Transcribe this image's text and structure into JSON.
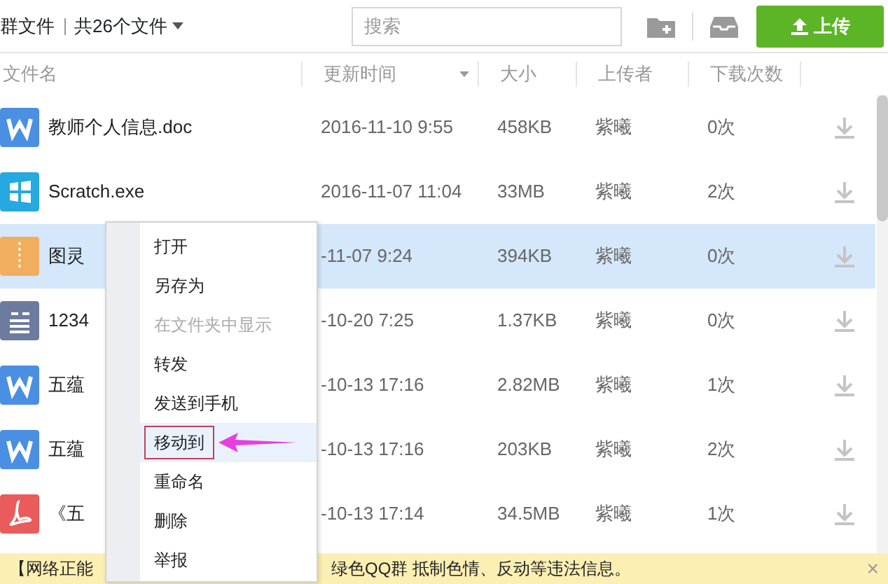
{
  "toolbar": {
    "title": "群文件",
    "file_count": "共26个文件",
    "search": {
      "placeholder": "搜索"
    },
    "upload_button": "上传"
  },
  "table": {
    "columns": [
      "文件名",
      "更新时间",
      "大小",
      "上传者",
      "下载次数"
    ],
    "rows": [
      {
        "kind": "doc",
        "name": "教师个人信息.doc",
        "time": "2016-11-10 9:55",
        "size": "458KB",
        "uploader": "紫曦",
        "downloads": "0次",
        "selected": false
      },
      {
        "kind": "exe",
        "name": "Scratch.exe",
        "time": "2016-11-07 11:04",
        "size": "33MB",
        "uploader": "紫曦",
        "downloads": "2次",
        "selected": false
      },
      {
        "kind": "zip",
        "name": "图灵",
        "time": "-11-07 9:24",
        "size": "394KB",
        "uploader": "紫曦",
        "downloads": "0次",
        "selected": true
      },
      {
        "kind": "txt",
        "name": "1234",
        "time": "-10-20 7:25",
        "size": "1.37KB",
        "uploader": "紫曦",
        "downloads": "0次",
        "selected": false
      },
      {
        "kind": "doc",
        "name": "五蕴",
        "time": "-10-13 17:16",
        "size": "2.82MB",
        "uploader": "紫曦",
        "downloads": "1次",
        "selected": false
      },
      {
        "kind": "doc",
        "name": "五蕴",
        "time": "-10-13 17:16",
        "size": "203KB",
        "uploader": "紫曦",
        "downloads": "2次",
        "selected": false
      },
      {
        "kind": "pdf",
        "name": "《五",
        "time": "-10-13 17:14",
        "size": "34.5MB",
        "uploader": "紫曦",
        "downloads": "1次",
        "selected": false
      }
    ]
  },
  "context_menu": [
    {
      "label": "打开",
      "disabled": false,
      "selected": false
    },
    {
      "label": "另存为",
      "disabled": false,
      "selected": false
    },
    {
      "label": "在文件夹中显示",
      "disabled": true,
      "selected": false
    },
    {
      "label": "转发",
      "disabled": false,
      "selected": false
    },
    {
      "label": "发送到手机",
      "disabled": false,
      "selected": false
    },
    {
      "label": "移动到",
      "disabled": false,
      "selected": true
    },
    {
      "label": "重命名",
      "disabled": false,
      "selected": false
    },
    {
      "label": "删除",
      "disabled": false,
      "selected": false
    },
    {
      "label": "举报",
      "disabled": false,
      "selected": false
    }
  ],
  "notice_bar": {
    "text_start": "【网络正能",
    "text_end": "绿色QQ群 抵制色情、反动等违法信息。",
    "close": "×"
  }
}
